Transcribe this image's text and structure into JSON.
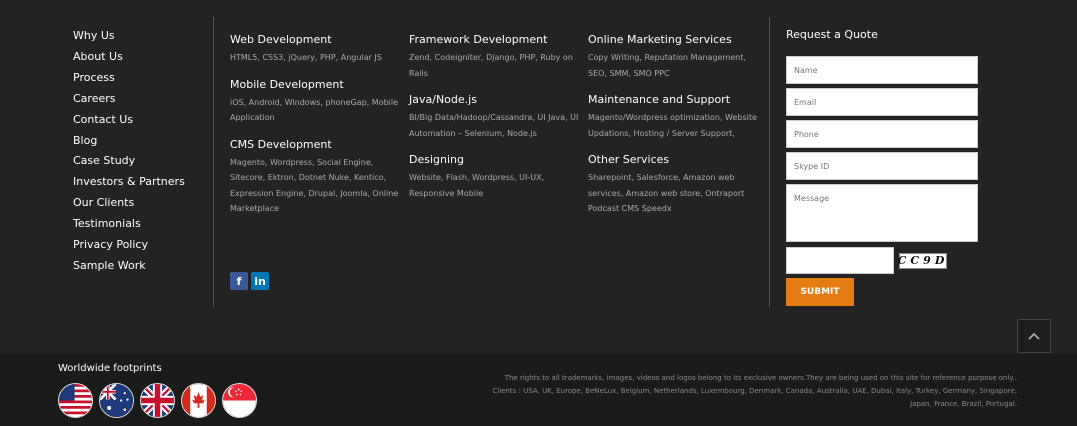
{
  "quick_links": [
    "Why Us",
    "About Us",
    "Process",
    "Careers",
    "Contact Us",
    "Blog",
    "Case Study",
    "Investors & Partners",
    "Our Clients",
    "Testimonials",
    "Privacy Policy",
    "Sample Work"
  ],
  "services": {
    "col1": [
      {
        "title": "Web Development",
        "desc": "HTML5, CSS3, jQuery, PHP, Angular JS"
      },
      {
        "title": "Mobile Development",
        "desc": "iOS, Android, Windows, phoneGap, Mobile Application"
      },
      {
        "title": "CMS Development",
        "desc": "Magento, Wordpress, Social Engine, Sitecore, Ektron, Dotnet Nuke, Kentico, Expression Engine, Drupal, Joomla, Online Marketplace"
      }
    ],
    "col2": [
      {
        "title": "Framework Development",
        "desc": "Zend, Codeigniter, Django, PHP, Ruby on Rails"
      },
      {
        "title": "Java/Node.js",
        "desc": "BI/Big Data/Hadoop/Cassandra, UI Java, UI Automation – Selenium, Node.js"
      },
      {
        "title": "Designing",
        "desc": "Website, Flash, Wordpress, UI-UX, Responsive Mobile"
      }
    ],
    "col3": [
      {
        "title": "Online Marketing Services",
        "desc": "Copy Writing, Reputation Management, SEO, SMM, SMO PPC"
      },
      {
        "title": "Maintenance and Support",
        "desc": "Magento/Wordpress optimization, Website Updations, Hosting / Server Support,"
      },
      {
        "title": "Other Services",
        "desc": "Sharepoint, Salesforce, Amazon web services, Amazon web store, Ontraport Podcast CMS Speedx"
      }
    ]
  },
  "social": {
    "facebook": "f",
    "linkedin": "in"
  },
  "quote": {
    "title": "Request a Quote",
    "name_placeholder": "Name",
    "email_placeholder": "Email",
    "phone_placeholder": "Phone",
    "skype_placeholder": "Skype ID",
    "message_placeholder": "Message",
    "captcha_text": "CC9D",
    "submit_label": "SUBMIT"
  },
  "footprints": {
    "title": "Worldwide footprints",
    "flags": [
      "usa-flag-icon",
      "australia-flag-icon",
      "uk-flag-icon",
      "canada-flag-icon",
      "singapore-flag-icon"
    ]
  },
  "legal": {
    "rights": "The rights to all trademarks, images, videos and logos belong to its exclusive owners.They are being used on this site for reference purpose only..",
    "clients": "Clients : USA, UK, Europe, BeNeLux, Belgium, Netherlands, Luxembourg, Denmark, Canada, Australia, UAE, Dubai, Italy, Turkey, Germany, Singapore, Japan, France, Brazil, Portugal."
  },
  "colors": {
    "accent": "#e47b13",
    "background": "#232323",
    "bottom_bar": "#1b1b1b"
  }
}
